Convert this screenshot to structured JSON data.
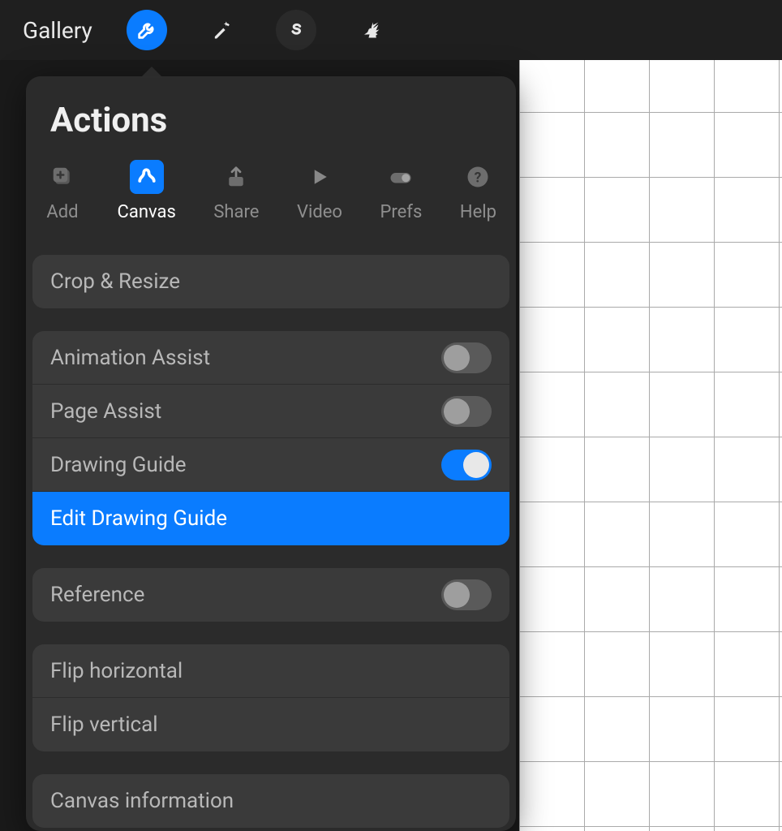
{
  "topbar": {
    "gallery": "Gallery"
  },
  "panel": {
    "title": "Actions",
    "tabs": {
      "add": "Add",
      "canvas": "Canvas",
      "share": "Share",
      "video": "Video",
      "prefs": "Prefs",
      "help": "Help"
    },
    "rows": {
      "crop": "Crop & Resize",
      "anim_assist": "Animation Assist",
      "page_assist": "Page Assist",
      "drawing_guide": "Drawing Guide",
      "edit_drawing_guide": "Edit Drawing Guide",
      "reference": "Reference",
      "flip_h": "Flip horizontal",
      "flip_v": "Flip vertical",
      "canvas_info": "Canvas information"
    },
    "toggles": {
      "anim_assist": false,
      "page_assist": false,
      "drawing_guide": true,
      "reference": false
    }
  },
  "colors": {
    "accent": "#0a7cff"
  }
}
